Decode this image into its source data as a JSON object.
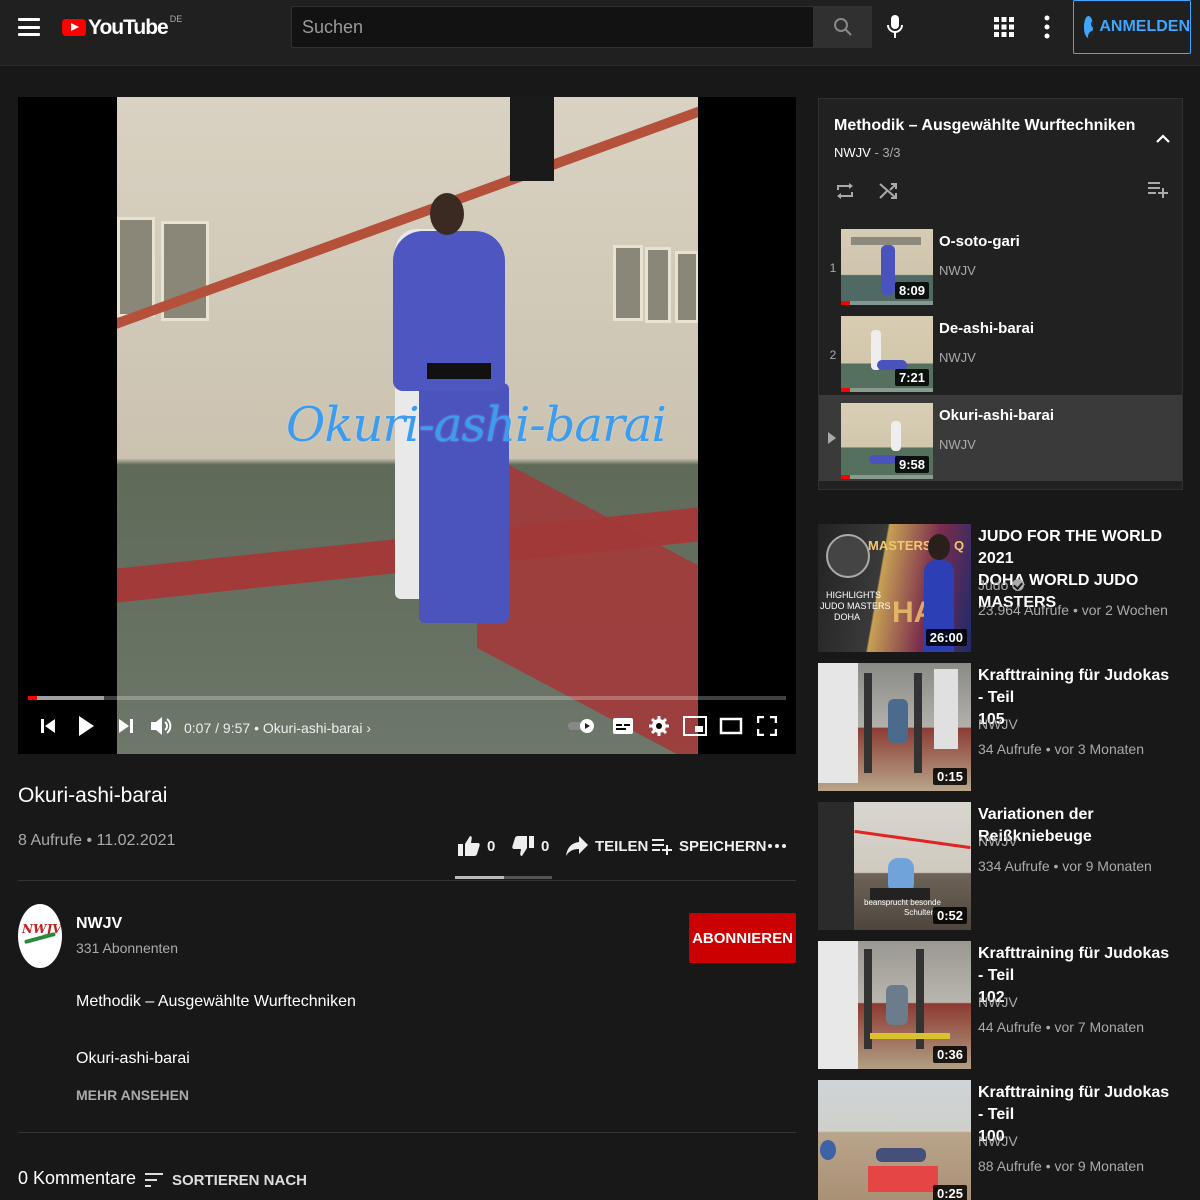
{
  "header": {
    "logo_text": "YouTube",
    "logo_region": "DE",
    "search_placeholder": "Suchen",
    "signin_label": "ANMELDEN"
  },
  "player": {
    "watermark": "Okuri-ashi-barai",
    "current_time": "0:07",
    "duration": "9:57",
    "chapter": "Okuri-ashi-barai",
    "played_fraction": 0.012,
    "buffered_fraction": 0.1
  },
  "video": {
    "title": "Okuri-ashi-barai",
    "views": "8 Aufrufe",
    "date": "11.02.2021",
    "likes": "0",
    "dislikes": "0",
    "share_label": "TEILEN",
    "save_label": "SPEICHERN",
    "like_ratio": 0.5
  },
  "channel": {
    "name": "NWJV",
    "subscribers": "331 Abonnenten",
    "subscribe_label": "ABONNIEREN",
    "avatar_text": "NWJV"
  },
  "description": {
    "line1": "Methodik – Ausgewählte Wurftechniken",
    "line2": "Okuri-ashi-barai",
    "more_label": "MEHR ANSEHEN"
  },
  "comments": {
    "count_label": "0 Kommentare",
    "sort_label": "SORTIEREN NACH"
  },
  "playlist": {
    "title": "Methodik – Ausgewählte Wurftechniken",
    "channel": "NWJV",
    "position": "3/3",
    "items": [
      {
        "index": "1",
        "title": "O-soto-gari",
        "channel": "NWJV",
        "duration": "8:09",
        "watched": 0.1
      },
      {
        "index": "2",
        "title": "De-ashi-barai",
        "channel": "NWJV",
        "duration": "7:21",
        "watched": 0.1
      },
      {
        "index": "",
        "title": "Okuri-ashi-barai",
        "channel": "NWJV",
        "duration": "9:58",
        "watched": 0.1
      }
    ]
  },
  "recommendations": [
    {
      "title_line1": "JUDO FOR THE WORLD 2021",
      "title_line2": "DOHA WORLD JUDO MASTERS",
      "channel": "Judo",
      "verified": true,
      "meta": "23.964 Aufrufe • vor 2 Wochen",
      "duration": "26:00",
      "thumb_text1": "HIGHLIGHTS",
      "thumb_text2": "JUDO MASTERS",
      "thumb_text3": "DOHA",
      "thumb_banner": "MASTERS 2 - Q",
      "thumb_banner2": "HA"
    },
    {
      "title_line1": "Krafttraining für Judokas - Teil",
      "title_line2": "105",
      "channel": "NWJV",
      "verified": false,
      "meta": "34 Aufrufe • vor 3 Monaten",
      "duration": "0:15"
    },
    {
      "title_line1": "Variationen der Reißkniebeuge",
      "title_line2": "",
      "channel": "NWJV",
      "verified": false,
      "meta": "334 Aufrufe • vor 9 Monaten",
      "duration": "0:52",
      "thumb_caption1": "beansprucht besonde",
      "thumb_caption2": "Schultern"
    },
    {
      "title_line1": "Krafttraining für Judokas - Teil",
      "title_line2": "102",
      "channel": "NWJV",
      "verified": false,
      "meta": "44 Aufrufe • vor 7 Monaten",
      "duration": "0:36"
    },
    {
      "title_line1": "Krafttraining für Judokas - Teil",
      "title_line2": "100",
      "channel": "NWJV",
      "verified": false,
      "meta": "88 Aufrufe • vor 9 Monaten",
      "duration": "0:25"
    }
  ]
}
